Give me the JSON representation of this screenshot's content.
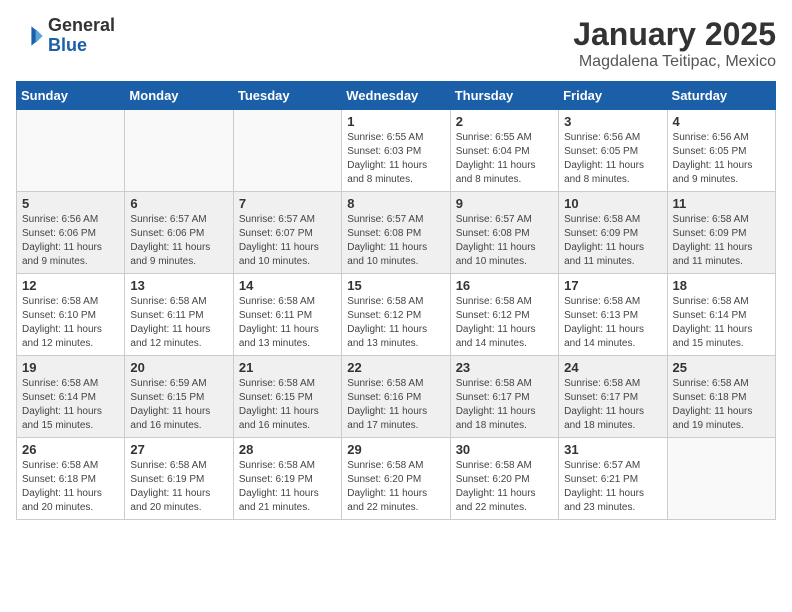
{
  "logo": {
    "text_general": "General",
    "text_blue": "Blue"
  },
  "title": "January 2025",
  "location": "Magdalena Teitipac, Mexico",
  "weekdays": [
    "Sunday",
    "Monday",
    "Tuesday",
    "Wednesday",
    "Thursday",
    "Friday",
    "Saturday"
  ],
  "weeks": [
    [
      {
        "day": "",
        "info": ""
      },
      {
        "day": "",
        "info": ""
      },
      {
        "day": "",
        "info": ""
      },
      {
        "day": "1",
        "info": "Sunrise: 6:55 AM\nSunset: 6:03 PM\nDaylight: 11 hours and 8 minutes."
      },
      {
        "day": "2",
        "info": "Sunrise: 6:55 AM\nSunset: 6:04 PM\nDaylight: 11 hours and 8 minutes."
      },
      {
        "day": "3",
        "info": "Sunrise: 6:56 AM\nSunset: 6:05 PM\nDaylight: 11 hours and 8 minutes."
      },
      {
        "day": "4",
        "info": "Sunrise: 6:56 AM\nSunset: 6:05 PM\nDaylight: 11 hours and 9 minutes."
      }
    ],
    [
      {
        "day": "5",
        "info": "Sunrise: 6:56 AM\nSunset: 6:06 PM\nDaylight: 11 hours and 9 minutes."
      },
      {
        "day": "6",
        "info": "Sunrise: 6:57 AM\nSunset: 6:06 PM\nDaylight: 11 hours and 9 minutes."
      },
      {
        "day": "7",
        "info": "Sunrise: 6:57 AM\nSunset: 6:07 PM\nDaylight: 11 hours and 10 minutes."
      },
      {
        "day": "8",
        "info": "Sunrise: 6:57 AM\nSunset: 6:08 PM\nDaylight: 11 hours and 10 minutes."
      },
      {
        "day": "9",
        "info": "Sunrise: 6:57 AM\nSunset: 6:08 PM\nDaylight: 11 hours and 10 minutes."
      },
      {
        "day": "10",
        "info": "Sunrise: 6:58 AM\nSunset: 6:09 PM\nDaylight: 11 hours and 11 minutes."
      },
      {
        "day": "11",
        "info": "Sunrise: 6:58 AM\nSunset: 6:09 PM\nDaylight: 11 hours and 11 minutes."
      }
    ],
    [
      {
        "day": "12",
        "info": "Sunrise: 6:58 AM\nSunset: 6:10 PM\nDaylight: 11 hours and 12 minutes."
      },
      {
        "day": "13",
        "info": "Sunrise: 6:58 AM\nSunset: 6:11 PM\nDaylight: 11 hours and 12 minutes."
      },
      {
        "day": "14",
        "info": "Sunrise: 6:58 AM\nSunset: 6:11 PM\nDaylight: 11 hours and 13 minutes."
      },
      {
        "day": "15",
        "info": "Sunrise: 6:58 AM\nSunset: 6:12 PM\nDaylight: 11 hours and 13 minutes."
      },
      {
        "day": "16",
        "info": "Sunrise: 6:58 AM\nSunset: 6:12 PM\nDaylight: 11 hours and 14 minutes."
      },
      {
        "day": "17",
        "info": "Sunrise: 6:58 AM\nSunset: 6:13 PM\nDaylight: 11 hours and 14 minutes."
      },
      {
        "day": "18",
        "info": "Sunrise: 6:58 AM\nSunset: 6:14 PM\nDaylight: 11 hours and 15 minutes."
      }
    ],
    [
      {
        "day": "19",
        "info": "Sunrise: 6:58 AM\nSunset: 6:14 PM\nDaylight: 11 hours and 15 minutes."
      },
      {
        "day": "20",
        "info": "Sunrise: 6:59 AM\nSunset: 6:15 PM\nDaylight: 11 hours and 16 minutes."
      },
      {
        "day": "21",
        "info": "Sunrise: 6:58 AM\nSunset: 6:15 PM\nDaylight: 11 hours and 16 minutes."
      },
      {
        "day": "22",
        "info": "Sunrise: 6:58 AM\nSunset: 6:16 PM\nDaylight: 11 hours and 17 minutes."
      },
      {
        "day": "23",
        "info": "Sunrise: 6:58 AM\nSunset: 6:17 PM\nDaylight: 11 hours and 18 minutes."
      },
      {
        "day": "24",
        "info": "Sunrise: 6:58 AM\nSunset: 6:17 PM\nDaylight: 11 hours and 18 minutes."
      },
      {
        "day": "25",
        "info": "Sunrise: 6:58 AM\nSunset: 6:18 PM\nDaylight: 11 hours and 19 minutes."
      }
    ],
    [
      {
        "day": "26",
        "info": "Sunrise: 6:58 AM\nSunset: 6:18 PM\nDaylight: 11 hours and 20 minutes."
      },
      {
        "day": "27",
        "info": "Sunrise: 6:58 AM\nSunset: 6:19 PM\nDaylight: 11 hours and 20 minutes."
      },
      {
        "day": "28",
        "info": "Sunrise: 6:58 AM\nSunset: 6:19 PM\nDaylight: 11 hours and 21 minutes."
      },
      {
        "day": "29",
        "info": "Sunrise: 6:58 AM\nSunset: 6:20 PM\nDaylight: 11 hours and 22 minutes."
      },
      {
        "day": "30",
        "info": "Sunrise: 6:58 AM\nSunset: 6:20 PM\nDaylight: 11 hours and 22 minutes."
      },
      {
        "day": "31",
        "info": "Sunrise: 6:57 AM\nSunset: 6:21 PM\nDaylight: 11 hours and 23 minutes."
      },
      {
        "day": "",
        "info": ""
      }
    ]
  ]
}
